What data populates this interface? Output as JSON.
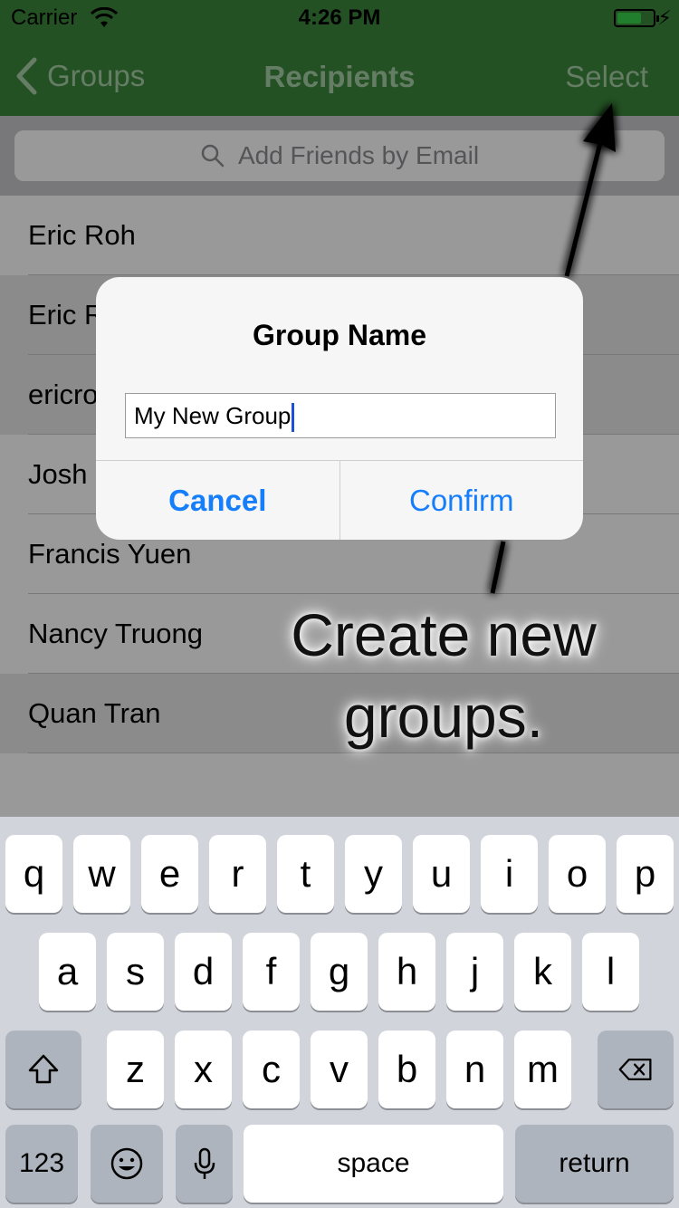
{
  "status_bar": {
    "carrier": "Carrier",
    "time": "4:26 PM"
  },
  "nav": {
    "back_label": "Groups",
    "title": "Recipients",
    "right_action": "Select"
  },
  "search": {
    "placeholder": "Add Friends by Email"
  },
  "contacts": [
    {
      "name": "Eric Roh"
    },
    {
      "name": "Eric R"
    },
    {
      "name": "ericro"
    },
    {
      "name": "Josh"
    },
    {
      "name": "Francis Yuen"
    },
    {
      "name": "Nancy Truong"
    },
    {
      "name": "Quan Tran"
    }
  ],
  "dialog": {
    "title": "Group Name",
    "input_value": "My New Group",
    "cancel_label": "Cancel",
    "confirm_label": "Confirm"
  },
  "annotation": {
    "line1": "Create new",
    "line2": "groups."
  },
  "keyboard": {
    "row1": [
      "q",
      "w",
      "e",
      "r",
      "t",
      "y",
      "u",
      "i",
      "o",
      "p"
    ],
    "row2": [
      "a",
      "s",
      "d",
      "f",
      "g",
      "h",
      "j",
      "k",
      "l"
    ],
    "row3": [
      "z",
      "x",
      "c",
      "v",
      "b",
      "n",
      "m"
    ],
    "numbers_label": "123",
    "space_label": "space",
    "return_label": "return"
  },
  "colors": {
    "nav_bar": "#3b873b",
    "accent": "#157efb"
  }
}
